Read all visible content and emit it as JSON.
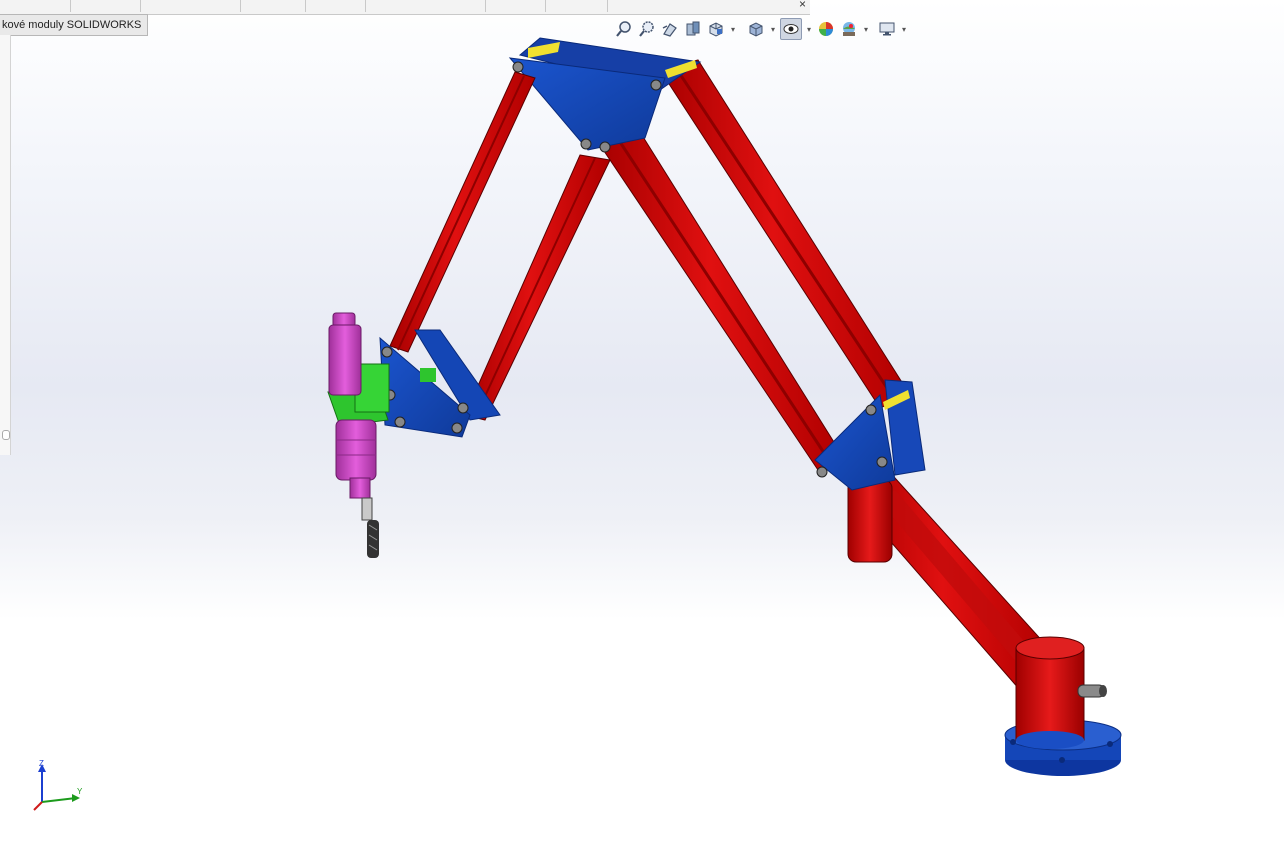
{
  "tab": {
    "label": "kové moduly SOLIDWORKS"
  },
  "window": {
    "close_glyph": "×"
  },
  "heads_up_toolbar": {
    "items": [
      {
        "icon": "zoom-to-fit-icon"
      },
      {
        "icon": "zoom-to-area-icon"
      },
      {
        "icon": "previous-view-icon"
      },
      {
        "icon": "section-view-icon"
      },
      {
        "icon": "view-orientation-icon",
        "dropdown": true
      },
      {
        "icon": "display-style-icon",
        "dropdown": true
      },
      {
        "icon": "hide-show-items-icon",
        "dropdown": true,
        "active": true
      },
      {
        "icon": "edit-appearance-icon"
      },
      {
        "icon": "apply-scene-icon",
        "dropdown": true
      },
      {
        "icon": "view-settings-icon",
        "dropdown": true
      }
    ]
  },
  "triad": {
    "z": "Z",
    "y": "Y"
  },
  "colors": {
    "arm_red": "#d50f0f",
    "plate_blue": "#1546b8",
    "tool_pink": "#d64fcf",
    "mount_green": "#2ec52e",
    "pin_yellow": "#f0e030"
  }
}
